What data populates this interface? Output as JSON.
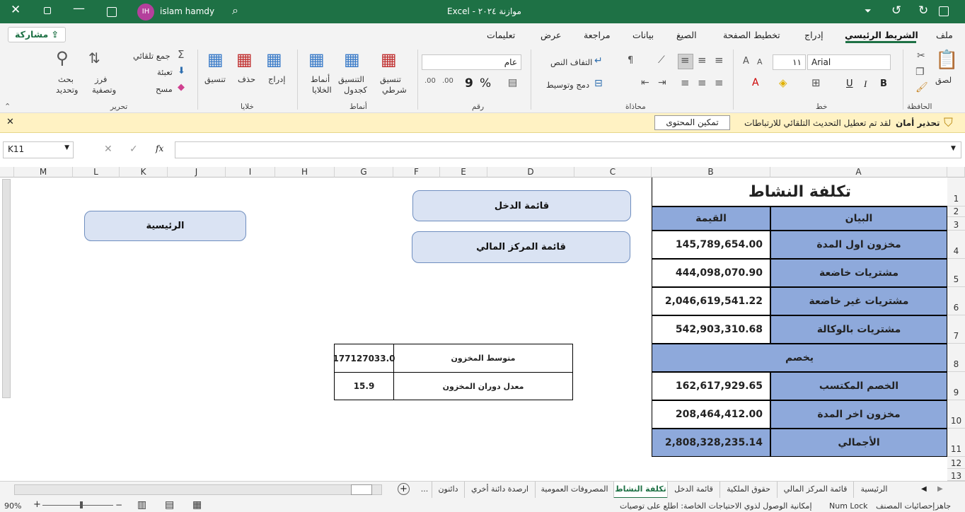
{
  "titlebar": {
    "file_name": "موازنة ٢٠٢٤",
    "app_sep": "-",
    "app": "Excel",
    "user_initials": "IH",
    "user_name": "islam hamdy"
  },
  "menu": {
    "tabs": [
      "ملف",
      "الشريط الرئيسي",
      "إدراج",
      "تخطيط الصفحة",
      "الصيغ",
      "بيانات",
      "مراجعة",
      "عرض",
      "تعليمات"
    ],
    "share": "مشاركة"
  },
  "ribbon": {
    "clipboard": {
      "paste": "لصق",
      "group": "الحافظة"
    },
    "font": {
      "name": "Arial",
      "size": "١١",
      "bold": "B",
      "italic": "I",
      "underline": "U",
      "group": "خط"
    },
    "alignment": {
      "wrap": "التفاف النص",
      "merge": "دمج وتوسيط",
      "group": "محاذاة"
    },
    "number": {
      "format": "عام",
      "percent": "%",
      "comma": "9",
      "group": "رقم"
    },
    "styles": {
      "conditional": "تنسيق",
      "conditional2": "شرطي",
      "table": "التنسيق",
      "table2": "كجدول",
      "cell": "أنماط",
      "cell2": "الخلايا",
      "group": "أنماط"
    },
    "cells": {
      "insert": "إدراج",
      "delete": "حذف",
      "format": "تنسيق",
      "group": "خلايا"
    },
    "editing": {
      "autosum": "جمع تلقائي",
      "fill": "تعبئة",
      "clear": "مسح",
      "sort": "فرز",
      "sort2": "وتصفية",
      "find": "بحث",
      "find2": "وتحديد",
      "group": "تحرير"
    }
  },
  "message": {
    "title": "تحذير أمان",
    "text": "لقد تم تعطيل التحديث التلقائي للارتباطات",
    "button": "تمكين المحتوى"
  },
  "formula": {
    "namebox": "K11",
    "fx": "fx",
    "value": ""
  },
  "columns": [
    "M",
    "L",
    "K",
    "J",
    "I",
    "H",
    "G",
    "F",
    "E",
    "D",
    "C",
    "B",
    "A"
  ],
  "rows": [
    "1",
    "2",
    "3",
    "4",
    "5",
    "6",
    "7",
    "8",
    "9",
    "10",
    "11",
    "12",
    "13"
  ],
  "table": {
    "title": "تكلفة النشاط",
    "head_label": "البيان",
    "head_value": "القيمة",
    "rows": [
      {
        "label": "مخزون اول المدة",
        "value": "145,789,654.00"
      },
      {
        "label": "مشتريات خاضعة",
        "value": "444,098,070.90"
      },
      {
        "label": "مشتريات غير خاضعة",
        "value": "2,046,619,541.22"
      },
      {
        "label": "مشتريات بالوكالة",
        "value": "542,903,310.68"
      }
    ],
    "deduct": "يخصم",
    "rows2": [
      {
        "label": "الخصم المكتسب",
        "value": "162,617,929.65"
      },
      {
        "label": "مخزون اخر المدة",
        "value": "208,464,412.00"
      }
    ],
    "total_label": "الأجمالي",
    "total_value": "2,808,328,235.14"
  },
  "buttons": {
    "income": "قائمة الدخل",
    "financial": "قائمة المركز المالي",
    "home": "الرئيسية"
  },
  "stats": {
    "avg_label": "متوسط المخزون",
    "avg_value": "177127033.0",
    "turn_label": "معدل دوران المخزون",
    "turn_value": "15.9"
  },
  "sheets": [
    "الرئيسية",
    "قائمة المركز المالي",
    "حقوق الملكية",
    "قائمة الدخل",
    "تكلفة النشاط",
    "المصروفات العمومية",
    "ارصدة دائنة أخري",
    "دائنون",
    "..."
  ],
  "status": {
    "ready": "جاهز",
    "stats": "إحصائيات المصنف",
    "numlock": "Num Lock",
    "accessibility": "إمكانية الوصول لذوي الاحتياجات الخاصة: اطلع على توصيات",
    "zoom": "90%"
  }
}
